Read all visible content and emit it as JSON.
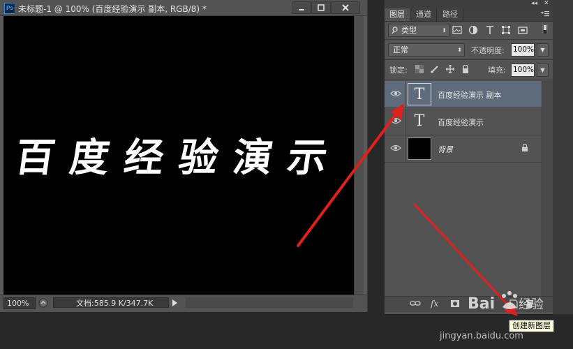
{
  "document_window": {
    "app_icon": "photoshop-icon",
    "app_icon_text": "Ps",
    "title": "未标题-1 @ 100% (百度经验演示 副本, RGB/8) *",
    "canvas_text": "百度经验演示",
    "status": {
      "zoom": "100%",
      "doc_size": "文档:585.9 K/347.7K"
    }
  },
  "layers_panel": {
    "tabs": [
      {
        "label": "图层",
        "active": true
      },
      {
        "label": "通道",
        "active": false
      },
      {
        "label": "路径",
        "active": false
      }
    ],
    "filter_kind": "类型",
    "blend_mode": "正常",
    "opacity_label": "不透明度:",
    "opacity_value": "100%",
    "lock_label": "锁定:",
    "fill_label": "填充:",
    "fill_value": "100%",
    "layers": [
      {
        "name": "百度经验演示 副本",
        "type": "text",
        "thumb": "T",
        "selected": true,
        "visible": true
      },
      {
        "name": "百度经验演示",
        "type": "text",
        "thumb": "T",
        "selected": false,
        "visible": true
      },
      {
        "name": "背景",
        "type": "background",
        "selected": false,
        "visible": true,
        "locked": true
      }
    ],
    "bottom_fx": "fx"
  },
  "tooltip": "创建新图层",
  "watermark": {
    "logo_text": "Bai",
    "logo_text_2": "经验",
    "url": "jingyan.baidu.com"
  },
  "colors": {
    "annotation_arrow": "#e0201c",
    "selected_layer": "#5f6a7a",
    "panel_bg": "#535353"
  }
}
